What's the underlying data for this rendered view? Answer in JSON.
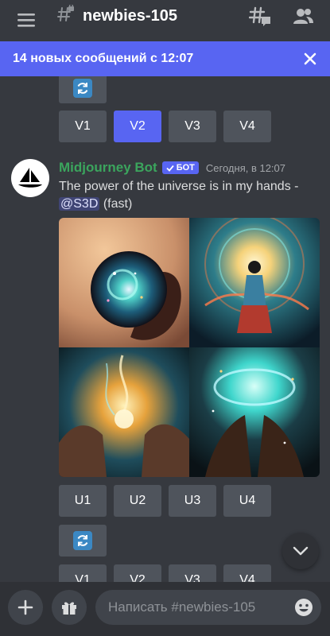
{
  "header": {
    "channel_name": "newbies-105",
    "menu_icon": "hamburger-menu-icon",
    "channel_icon": "locked-hash-icon",
    "threads_icon": "threads-icon",
    "members_icon": "members-icon"
  },
  "new_messages_bar": {
    "text": "14 новых сообщений с 12:07",
    "close_icon": "close-icon"
  },
  "previous_message": {
    "version_buttons": [
      "V1",
      "V2",
      "V3",
      "V4"
    ],
    "active_version": "V2"
  },
  "message": {
    "author": "Midjourney Bot",
    "bot_tag": "БОТ",
    "timestamp": "Сегодня, в 12:07",
    "text": "The power of the universe is in my hands -",
    "mention": "@S3D",
    "suffix": "(fast)",
    "upscale_buttons": [
      "U1",
      "U2",
      "U3",
      "U4"
    ],
    "variation_buttons": [
      "V1",
      "V2",
      "V3",
      "V4"
    ]
  },
  "composer": {
    "placeholder": "Написать #newbies-105"
  },
  "colors": {
    "background": "#36393f",
    "accent": "#5865f2",
    "bot_name": "#3ba55d",
    "button": "#4f545c"
  }
}
